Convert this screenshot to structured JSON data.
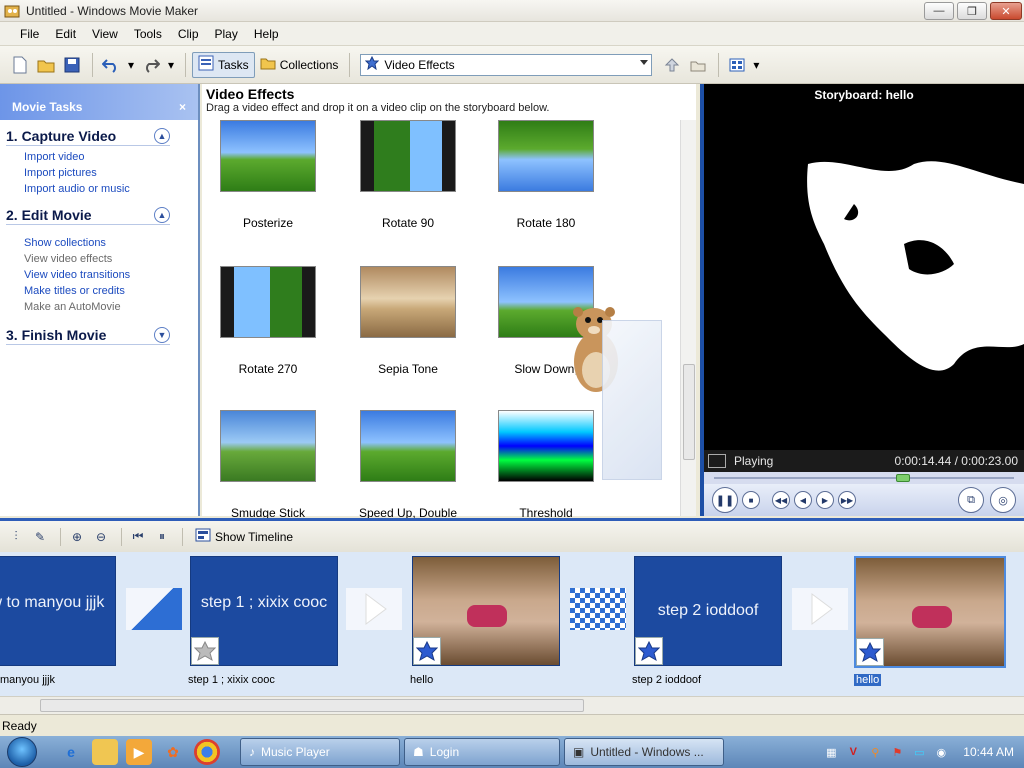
{
  "window": {
    "title": "Untitled - Windows Movie Maker",
    "minimize": "0",
    "maximize": "1",
    "close": "r"
  },
  "menu": [
    "File",
    "Edit",
    "View",
    "Tools",
    "Clip",
    "Play",
    "Help"
  ],
  "toolbar": {
    "tasks_label": "Tasks",
    "collections_label": "Collections",
    "effects_select": "Video Effects"
  },
  "taskpane": {
    "title": "Movie Tasks",
    "close": "×",
    "sections": [
      {
        "title": "1. Capture Video",
        "links": [
          {
            "label": "Import video",
            "enabled": true
          },
          {
            "label": "Import pictures",
            "enabled": true
          },
          {
            "label": "Import audio or music",
            "enabled": true
          }
        ]
      },
      {
        "title": "2. Edit Movie",
        "links": [
          {
            "label": "Show collections",
            "enabled": true
          },
          {
            "label": "View video effects",
            "enabled": false
          },
          {
            "label": "View video transitions",
            "enabled": true
          },
          {
            "label": "Make titles or credits",
            "enabled": true
          },
          {
            "label": "Make an AutoMovie",
            "enabled": false
          }
        ]
      },
      {
        "title": "3. Finish Movie",
        "links": []
      }
    ]
  },
  "effects": {
    "title": "Video Effects",
    "subtitle": "Drag a video effect and drop it on a video clip on the storyboard below.",
    "items": [
      {
        "label": "Posterize"
      },
      {
        "label": "Rotate 90"
      },
      {
        "label": "Rotate 180"
      },
      {
        "label": "Rotate 270"
      },
      {
        "label": "Sepia Tone"
      },
      {
        "label": "Slow Down,"
      },
      {
        "label": "Smudge Stick"
      },
      {
        "label": "Speed Up, Double"
      },
      {
        "label": "Threshold"
      }
    ]
  },
  "preview": {
    "title": "Storyboard: hello",
    "status": "Playing",
    "time": "0:00:14.44 / 0:00:23.00",
    "progress": 0.63
  },
  "storyboard": {
    "show_timeline": "Show Timeline",
    "clips": [
      {
        "caption": "manyou jjjk",
        "text": "ow to manyou jjjk",
        "kind": "title"
      },
      {
        "caption": "step 1 ; xixix cooc",
        "text": "step 1 ; xixix cooc",
        "kind": "title"
      },
      {
        "caption": "hello",
        "text": "",
        "kind": "photo"
      },
      {
        "caption": "step 2 ioddoof",
        "text": "step 2 ioddoof",
        "kind": "title"
      },
      {
        "caption": "hello",
        "text": "",
        "kind": "photo",
        "selected": true
      }
    ]
  },
  "statusbar": {
    "text": "Ready"
  },
  "taskbar": {
    "buttons": [
      {
        "label": "Music Player",
        "active": false
      },
      {
        "label": "Login",
        "active": false
      },
      {
        "label": "Untitled - Windows ...",
        "active": true
      }
    ],
    "clock": "10:44 AM"
  }
}
